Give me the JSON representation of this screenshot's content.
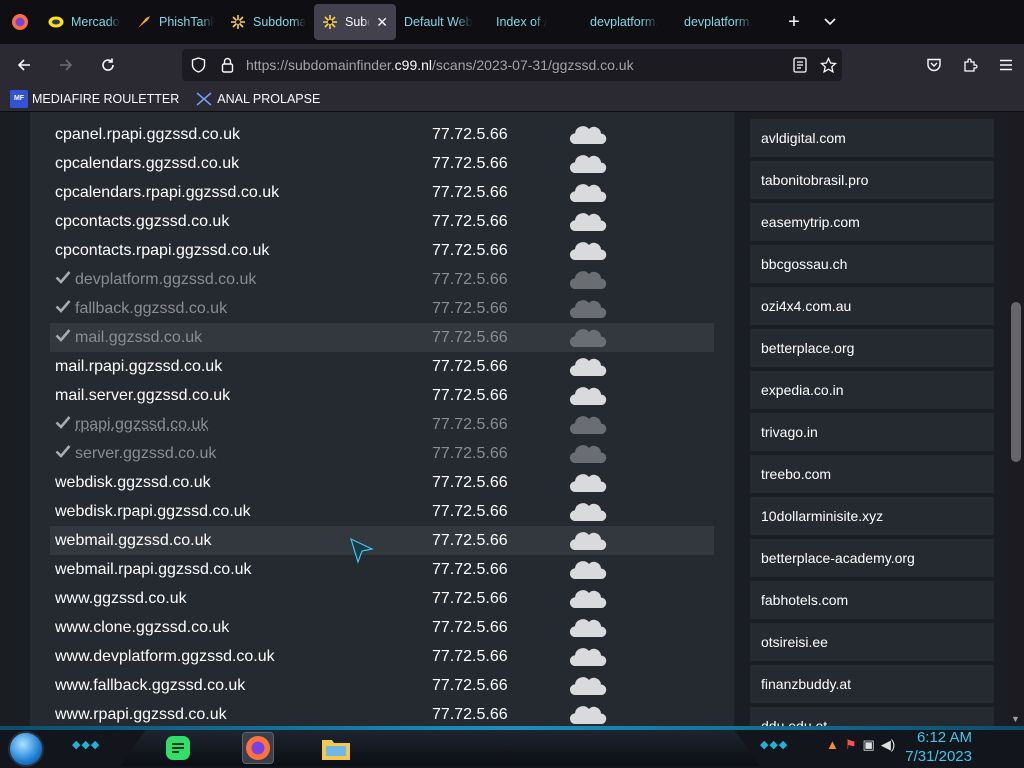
{
  "tabs": [
    {
      "label": "Mercado",
      "icon": "mercado-icon",
      "active": false
    },
    {
      "label": "PhishTank",
      "icon": "phishtank-icon",
      "active": false
    },
    {
      "label": "Subdomain",
      "icon": "subdomain-finder-icon",
      "active": false
    },
    {
      "label": "Subdomain",
      "icon": "subdomain-finder-icon",
      "active": true
    },
    {
      "label": "Default Web",
      "icon": "",
      "active": false
    },
    {
      "label": "Index of /",
      "icon": "",
      "active": false
    },
    {
      "label": "devplatform.",
      "icon": "",
      "active": false
    },
    {
      "label": "devplatform.",
      "icon": "",
      "active": false
    }
  ],
  "url": {
    "prefix": "https://subdomainfinder.",
    "domain": "c99.nl",
    "path": "/scans/2023-07-31/ggzssd.co.uk"
  },
  "bookmarks": [
    {
      "label": "MEDIAFIRE ROULETTER",
      "icon_text": "MF"
    },
    {
      "label": "ANAL PROLAPSE",
      "icon_text": ""
    }
  ],
  "subdomains": [
    {
      "name": "cpanel.rpapi.ggzssd.co.uk",
      "ip": "77.72.5.66",
      "checked": false
    },
    {
      "name": "cpcalendars.ggzssd.co.uk",
      "ip": "77.72.5.66",
      "checked": false
    },
    {
      "name": "cpcalendars.rpapi.ggzssd.co.uk",
      "ip": "77.72.5.66",
      "checked": false
    },
    {
      "name": "cpcontacts.ggzssd.co.uk",
      "ip": "77.72.5.66",
      "checked": false
    },
    {
      "name": "cpcontacts.rpapi.ggzssd.co.uk",
      "ip": "77.72.5.66",
      "checked": false
    },
    {
      "name": "devplatform.ggzssd.co.uk",
      "ip": "77.72.5.66",
      "checked": true
    },
    {
      "name": "fallback.ggzssd.co.uk",
      "ip": "77.72.5.66",
      "checked": true
    },
    {
      "name": "mail.ggzssd.co.uk",
      "ip": "77.72.5.66",
      "checked": true
    },
    {
      "name": "mail.rpapi.ggzssd.co.uk",
      "ip": "77.72.5.66",
      "checked": false
    },
    {
      "name": "mail.server.ggzssd.co.uk",
      "ip": "77.72.5.66",
      "checked": false
    },
    {
      "name": "rpapi.ggzssd.co.uk",
      "ip": "77.72.5.66",
      "checked": true
    },
    {
      "name": "server.ggzssd.co.uk",
      "ip": "77.72.5.66",
      "checked": true
    },
    {
      "name": "webdisk.ggzssd.co.uk",
      "ip": "77.72.5.66",
      "checked": false
    },
    {
      "name": "webdisk.rpapi.ggzssd.co.uk",
      "ip": "77.72.5.66",
      "checked": false
    },
    {
      "name": "webmail.ggzssd.co.uk",
      "ip": "77.72.5.66",
      "checked": false
    },
    {
      "name": "webmail.rpapi.ggzssd.co.uk",
      "ip": "77.72.5.66",
      "checked": false
    },
    {
      "name": "www.ggzssd.co.uk",
      "ip": "77.72.5.66",
      "checked": false
    },
    {
      "name": "www.clone.ggzssd.co.uk",
      "ip": "77.72.5.66",
      "checked": false
    },
    {
      "name": "www.devplatform.ggzssd.co.uk",
      "ip": "77.72.5.66",
      "checked": false
    },
    {
      "name": "www.fallback.ggzssd.co.uk",
      "ip": "77.72.5.66",
      "checked": false
    },
    {
      "name": "www.rpapi.ggzssd.co.uk",
      "ip": "77.72.5.66",
      "checked": false
    }
  ],
  "related_domains": [
    "avldigital.com",
    "tabonitobrasil.pro",
    "easemytrip.com",
    "bbcgossau.ch",
    "ozi4x4.com.au",
    "betterplace.org",
    "expedia.co.in",
    "trivago.in",
    "treebo.com",
    "10dollarminisite.xyz",
    "betterplace-academy.org",
    "fabhotels.com",
    "otsireisi.ee",
    "finanzbuddy.at",
    "ddu.edu.et"
  ],
  "clock": {
    "time": "6:12 AM",
    "date": "7/31/2023"
  },
  "colors": {
    "accent": "#3fc6ea",
    "tab_text": "#7fd8e6",
    "page_bg": "#1a1d22",
    "panel_bg": "#252930"
  }
}
